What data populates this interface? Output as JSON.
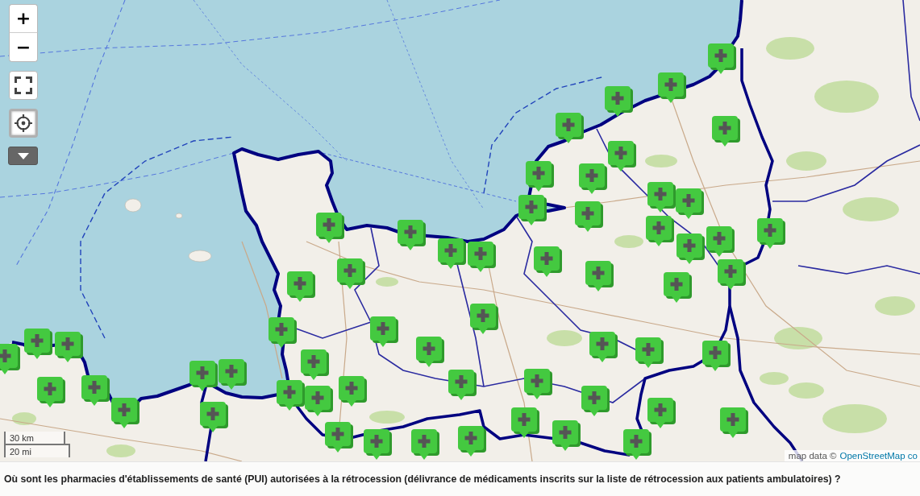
{
  "map_controls": {
    "zoom_in": "+",
    "zoom_out": "−"
  },
  "scale": {
    "metric": "30 km",
    "imperial": "20 mi"
  },
  "attribution": {
    "prefix": "map data ©",
    "link": "OpenStreetMap co"
  },
  "caption": "Où sont les pharmacies d'établissements de santé (PUI) autorisées à la rétrocession (délivrance de médicaments inscrits sur la liste de rétrocession aux patients ambulatoires) ?"
}
